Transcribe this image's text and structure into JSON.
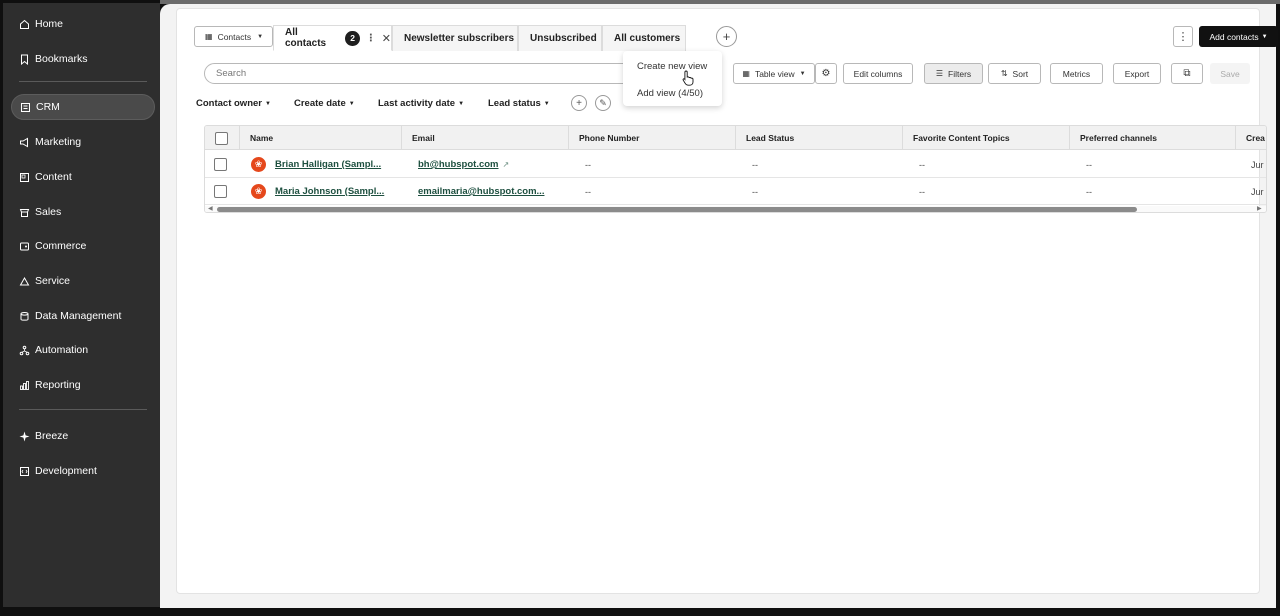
{
  "sidebar": {
    "items": [
      {
        "label": "Home",
        "icon": "home-icon"
      },
      {
        "label": "Bookmarks",
        "icon": "bookmark-icon"
      },
      {
        "label": "CRM",
        "icon": "crm-icon",
        "active": true
      },
      {
        "label": "Marketing",
        "icon": "megaphone-icon"
      },
      {
        "label": "Content",
        "icon": "content-icon"
      },
      {
        "label": "Sales",
        "icon": "sales-icon"
      },
      {
        "label": "Commerce",
        "icon": "commerce-icon"
      },
      {
        "label": "Service",
        "icon": "service-icon"
      },
      {
        "label": "Data Management",
        "icon": "database-icon"
      },
      {
        "label": "Automation",
        "icon": "automation-icon"
      },
      {
        "label": "Reporting",
        "icon": "chart-icon"
      },
      {
        "label": "Breeze",
        "icon": "sparkle-icon"
      },
      {
        "label": "Development",
        "icon": "code-icon"
      }
    ]
  },
  "header": {
    "object_selector": "Contacts",
    "tabs": [
      {
        "label": "All contacts",
        "badge": "2",
        "active": true
      },
      {
        "label": "Newsletter subscribers"
      },
      {
        "label": "Unsubscribed"
      },
      {
        "label": "All customers"
      }
    ],
    "add_contacts_label": "Add contacts"
  },
  "toolbar": {
    "search_placeholder": "Search",
    "table_view_label": "Table view",
    "edit_columns_label": "Edit columns",
    "filters_label": "Filters",
    "sort_label": "Sort",
    "metrics_label": "Metrics",
    "export_label": "Export",
    "save_label": "Save"
  },
  "filters": [
    {
      "label": "Contact owner"
    },
    {
      "label": "Create date"
    },
    {
      "label": "Last activity date"
    },
    {
      "label": "Lead status"
    }
  ],
  "table": {
    "columns": [
      "Name",
      "Email",
      "Phone Number",
      "Lead Status",
      "Favorite Content Topics",
      "Preferred channels",
      "Crea"
    ],
    "rows": [
      {
        "name": "Brian Halligan (Sampl...",
        "email": "bh@hubspot.com",
        "phone": "--",
        "lead_status": "--",
        "topics": "--",
        "channels": "--",
        "created": "Jur"
      },
      {
        "name": "Maria Johnson (Sampl...",
        "email": "emailmaria@hubspot.com...",
        "phone": "--",
        "lead_status": "--",
        "topics": "--",
        "channels": "--",
        "created": "Jur"
      }
    ]
  },
  "dropdown": {
    "items": [
      "Create new view",
      "Add view (4/50)"
    ]
  },
  "colors": {
    "sidebar_bg": "#2e2e2e",
    "primary_button": "#111111",
    "avatar": "#e5481c",
    "link": "#1d4f3f"
  }
}
